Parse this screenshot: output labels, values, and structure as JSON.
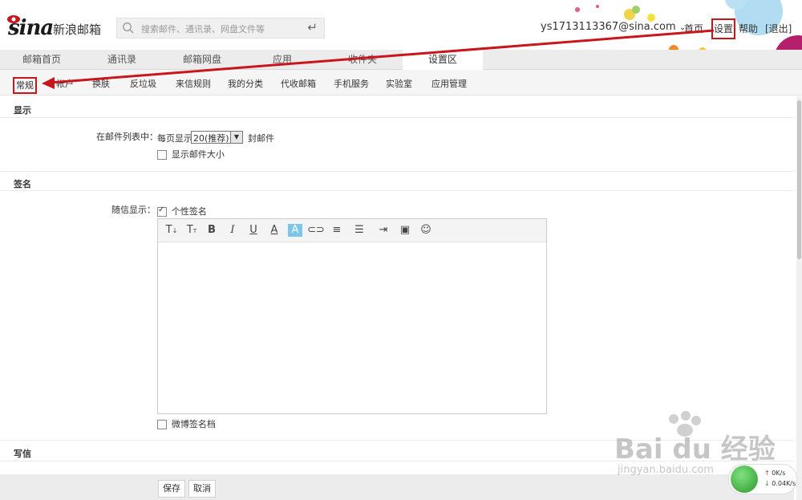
{
  "header": {
    "logo_text": "sina",
    "product_name": "新浪邮箱",
    "search_placeholder": "搜索邮件、通讯录、网盘文件等",
    "user_email": "ys1713113367@sina.com",
    "links": {
      "home": "首页",
      "settings": "设置",
      "help": "帮助",
      "logout": "[退出]"
    }
  },
  "tabs": [
    {
      "label": "邮箱首页"
    },
    {
      "label": "通讯录"
    },
    {
      "label": "邮箱网盘"
    },
    {
      "label": "应用"
    },
    {
      "label": "收件夹"
    },
    {
      "label": "设置区"
    }
  ],
  "subtabs": [
    {
      "label": "常规"
    },
    {
      "label": "帐户"
    },
    {
      "label": "换肤"
    },
    {
      "label": "反垃圾"
    },
    {
      "label": "来信规则"
    },
    {
      "label": "我的分类"
    },
    {
      "label": "代收邮箱"
    },
    {
      "label": "手机服务"
    },
    {
      "label": "实验室"
    },
    {
      "label": "应用管理"
    }
  ],
  "display": {
    "title": "显示",
    "list_label": "在邮件列表中：",
    "per_page_label": "每页显示",
    "per_page_value": "20(推荐)",
    "per_page_suffix": "封邮件",
    "show_size_label": "显示邮件大小",
    "show_size_checked": false
  },
  "signature": {
    "title": "签名",
    "attach_label": "随信显示：",
    "personal_label": "个性签名",
    "personal_checked": true,
    "weibo_label": "微博签名档",
    "weibo_checked": false
  },
  "compose": {
    "title": "写信"
  },
  "buttons": {
    "save": "保存",
    "cancel": "取消"
  },
  "netspeed": {
    "up": "0K/s",
    "down": "0.04K/s"
  },
  "watermark": {
    "brand": "Bai du 经验",
    "url": "jingyan.baidu.com"
  },
  "colors": {
    "annotation_red": "#c8161d",
    "tab_bg": "#ececec"
  }
}
